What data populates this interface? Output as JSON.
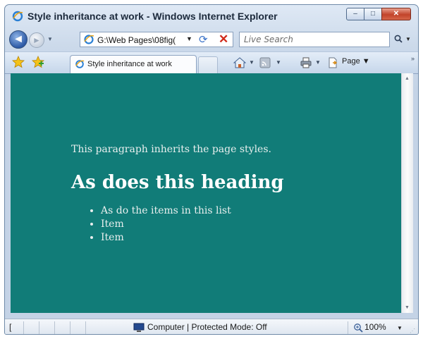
{
  "window": {
    "title": "Style inheritance at work - Windows Internet Explorer",
    "controls": {
      "minimize": "–",
      "maximize": "□",
      "close": "✕"
    }
  },
  "nav": {
    "address": "G:\\Web Pages\\08fig(",
    "search_placeholder": "Live Search"
  },
  "toolbar": {
    "tab_label": "Style inheritance at work",
    "page_menu": "Page",
    "chevron": "»"
  },
  "content": {
    "paragraph": "This paragraph inherits the page styles.",
    "heading": "As does this heading",
    "list_items": [
      "As do the items in this list",
      "Item",
      "Item"
    ]
  },
  "status": {
    "left_text": "[",
    "zone": "Computer | Protected Mode: Off",
    "zoom": "100%"
  },
  "colors": {
    "page_background": "#117c78",
    "text": "#e8efee",
    "heading": "#ffffff"
  },
  "icons": [
    "ie-icon",
    "back-arrow-icon",
    "forward-arrow-icon",
    "refresh-icon",
    "stop-icon",
    "search-icon",
    "favorites-star-icon",
    "add-favorites-icon",
    "home-icon",
    "feeds-icon",
    "print-icon",
    "page-icon",
    "computer-icon",
    "zoom-icon"
  ]
}
